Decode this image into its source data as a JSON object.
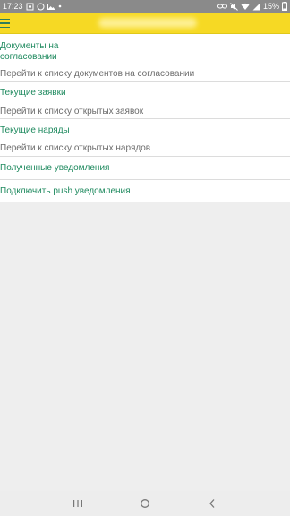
{
  "status_bar": {
    "time": "17:23",
    "battery": "15%",
    "icons_left": [
      "screenshot-icon",
      "whatsapp-icon",
      "gallery-icon",
      "dot-icon"
    ],
    "icons_right": [
      "link-icon",
      "mute-icon",
      "wifi-icon",
      "signal-icon",
      "battery-icon"
    ]
  },
  "header": {
    "menu_icon": "hamburger-menu-icon",
    "title_blurred": true,
    "background_color": "#f6d924",
    "accent_color": "#2e7d5b"
  },
  "menu": {
    "items": [
      {
        "title": "Документы на согласовании",
        "subtitle": "Перейти к списку документов на согласовании"
      },
      {
        "title": "Текущие заявки",
        "subtitle": "Перейти к списку открытых заявок"
      },
      {
        "title": "Текущие наряды",
        "subtitle": "Перейти к списку открытых нарядов"
      },
      {
        "title": "Полученные уведомления"
      },
      {
        "title": "Подключить push уведомления"
      }
    ],
    "title_color": "#1f8a5f",
    "subtitle_color": "#6b6b6b"
  },
  "nav_bar": {
    "buttons": [
      "recents-icon",
      "home-icon",
      "back-icon"
    ]
  }
}
